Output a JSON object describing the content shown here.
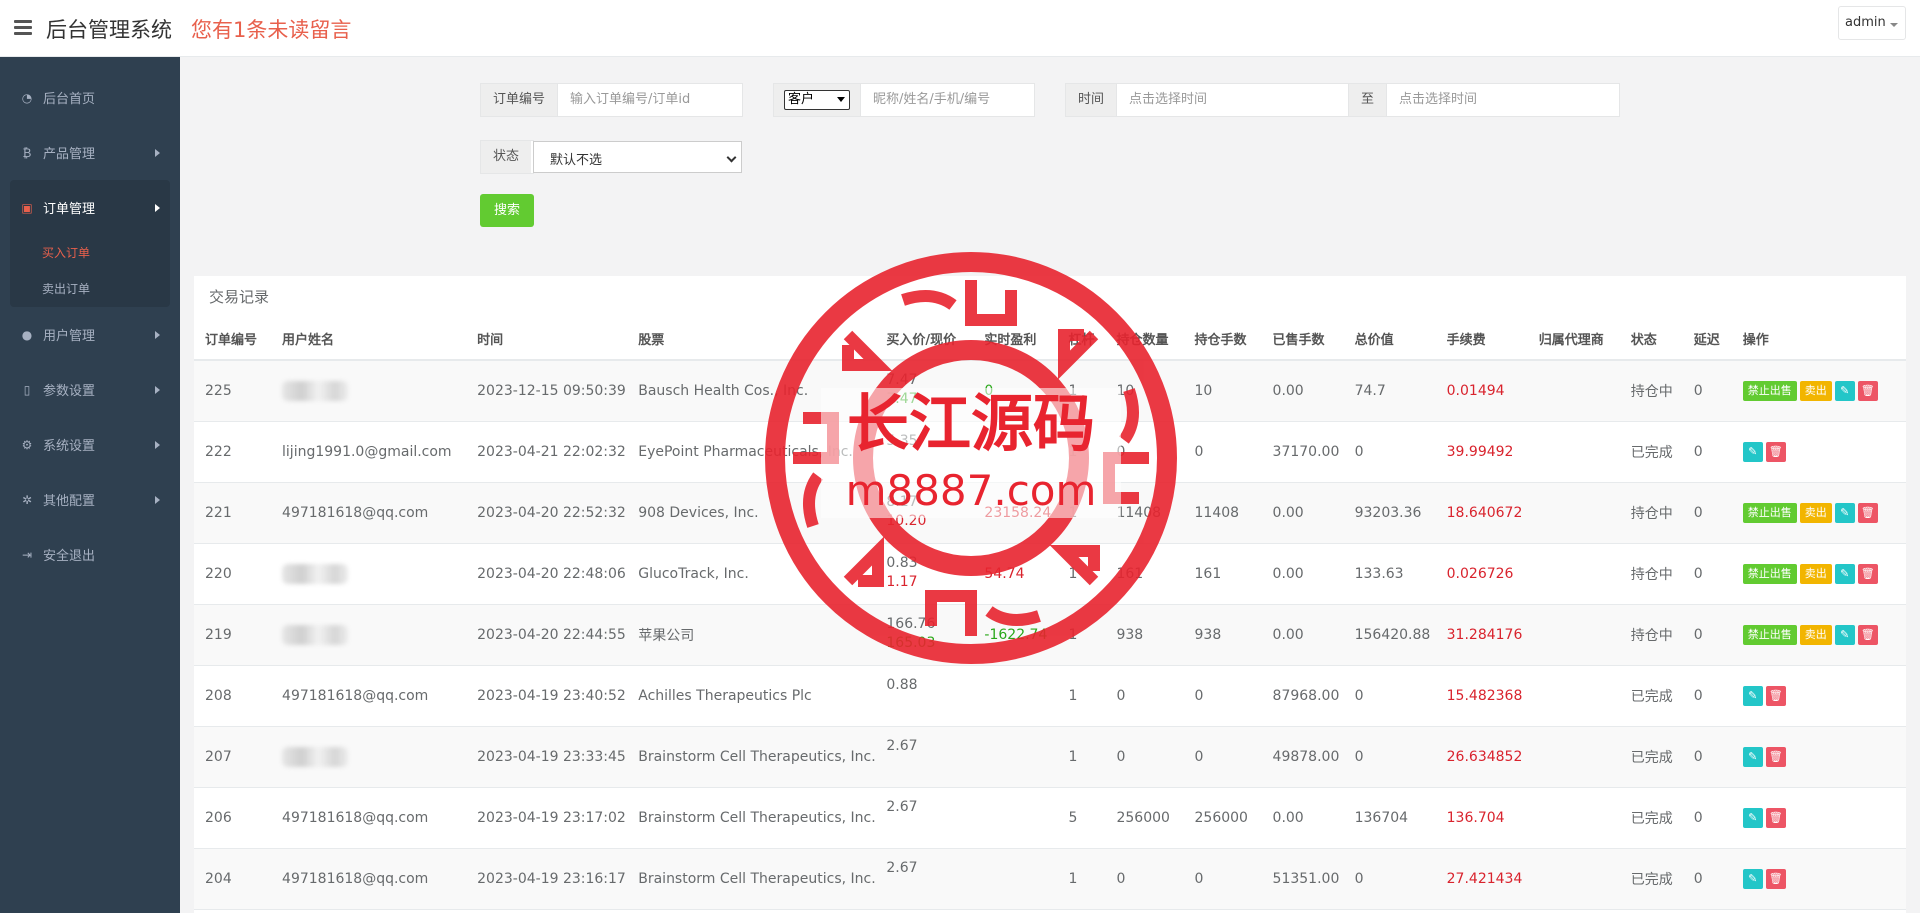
{
  "header": {
    "title": "后台管理系统",
    "unread_notice": "您有1条未读留言",
    "user_menu": "admin"
  },
  "sidebar": {
    "items": [
      {
        "label": "后台首页",
        "icon": "dashboard-icon"
      },
      {
        "label": "产品管理",
        "icon": "bitcoin-icon"
      },
      {
        "label": "订单管理",
        "icon": "orders-icon",
        "expanded": true
      },
      {
        "label": "用户管理",
        "icon": "user-icon"
      },
      {
        "label": "参数设置",
        "icon": "file-icon"
      },
      {
        "label": "系统设置",
        "icon": "gears-icon"
      },
      {
        "label": "其他配置",
        "icon": "gear-icon"
      },
      {
        "label": "安全退出",
        "icon": "signout-icon"
      }
    ],
    "order_submenu": [
      {
        "label": "买入订单",
        "active": true
      },
      {
        "label": "卖出订单",
        "active": false
      }
    ]
  },
  "filters": {
    "order_no_label": "订单编号",
    "order_no_placeholder": "输入订单编号/订单id",
    "customer_select": "客户",
    "customer_placeholder": "昵称/姓名/手机/编号",
    "time_label": "时间",
    "time_start_placeholder": "点击选择时间",
    "time_to": "至",
    "time_end_placeholder": "点击选择时间",
    "status_label": "状态",
    "status_value": "默认不选",
    "search_button": "搜索"
  },
  "table": {
    "title": "交易记录",
    "columns": [
      "订单编号",
      "用户姓名",
      "时间",
      "股票",
      "买入价/现价",
      "实时盈利",
      "杠杆",
      "持仓数量",
      "持仓手数",
      "已售手数",
      "总价值",
      "手续费",
      "归属代理商",
      "状态",
      "延迟",
      "操作"
    ],
    "action_labels": {
      "disable_sell": "禁止出售",
      "sell": "卖出"
    },
    "rows": [
      {
        "id": "225",
        "user": "",
        "time": "2023-12-15 09:50:39",
        "stock": "Bausch Health Cos., Inc.",
        "buy": "7.47",
        "cur": "7.47",
        "profit": "0",
        "profit_color": "green",
        "lev": "1",
        "hold_qty": "10",
        "hold_lots": "10",
        "sold": "0.00",
        "total": "74.7",
        "fee": "0.01494",
        "agent": "",
        "status": "持仓中",
        "delay": "0",
        "open": true
      },
      {
        "id": "222",
        "user": "lijing1991.0@gmail.com",
        "time": "2023-04-21 22:02:32",
        "stock": "EyePoint Pharmaceuticals, Inc.",
        "buy": "5.35",
        "cur": "",
        "profit": "",
        "profit_color": "",
        "lev": "1",
        "hold_qty": "0",
        "hold_lots": "0",
        "sold": "37170.00",
        "total": "0",
        "fee": "39.99492",
        "agent": "",
        "status": "已完成",
        "delay": "0",
        "open": false
      },
      {
        "id": "221",
        "user": "497181618@qq.com",
        "time": "2023-04-20 22:52:32",
        "stock": "908 Devices, Inc.",
        "buy": "8.17",
        "cur": "10.20",
        "profit": "23158.24",
        "profit_color": "red",
        "lev": "1",
        "hold_qty": "11408",
        "hold_lots": "11408",
        "sold": "0.00",
        "total": "93203.36",
        "fee": "18.640672",
        "agent": "",
        "status": "持仓中",
        "delay": "0",
        "open": true
      },
      {
        "id": "220",
        "user": "",
        "time": "2023-04-20 22:48:06",
        "stock": "GlucoTrack, Inc.",
        "buy": "0.83",
        "cur": "1.17",
        "profit": "54.74",
        "profit_color": "red",
        "lev": "1",
        "hold_qty": "161",
        "hold_lots": "161",
        "sold": "0.00",
        "total": "133.63",
        "fee": "0.026726",
        "agent": "",
        "status": "持仓中",
        "delay": "0",
        "open": true
      },
      {
        "id": "219",
        "user": "",
        "time": "2023-04-20 22:44:55",
        "stock": "苹果公司",
        "buy": "166.76",
        "cur": "165.03",
        "profit": "-1622.74",
        "profit_color": "green",
        "lev": "1",
        "hold_qty": "938",
        "hold_lots": "938",
        "sold": "0.00",
        "total": "156420.88",
        "fee": "31.284176",
        "agent": "",
        "status": "持仓中",
        "delay": "0",
        "open": true
      },
      {
        "id": "208",
        "user": "497181618@qq.com",
        "time": "2023-04-19 23:40:52",
        "stock": "Achilles Therapeutics Plc",
        "buy": "0.88",
        "cur": "",
        "profit": "",
        "profit_color": "",
        "lev": "1",
        "hold_qty": "0",
        "hold_lots": "0",
        "sold": "87968.00",
        "total": "0",
        "fee": "15.482368",
        "agent": "",
        "status": "已完成",
        "delay": "0",
        "open": false
      },
      {
        "id": "207",
        "user": "",
        "time": "2023-04-19 23:33:45",
        "stock": "Brainstorm Cell Therapeutics, Inc.",
        "buy": "2.67",
        "cur": "",
        "profit": "",
        "profit_color": "",
        "lev": "1",
        "hold_qty": "0",
        "hold_lots": "0",
        "sold": "49878.00",
        "total": "0",
        "fee": "26.634852",
        "agent": "",
        "status": "已完成",
        "delay": "0",
        "open": false
      },
      {
        "id": "206",
        "user": "497181618@qq.com",
        "time": "2023-04-19 23:17:02",
        "stock": "Brainstorm Cell Therapeutics, Inc.",
        "buy": "2.67",
        "cur": "",
        "profit": "",
        "profit_color": "",
        "lev": "5",
        "hold_qty": "256000",
        "hold_lots": "256000",
        "sold": "0.00",
        "total": "136704",
        "fee": "136.704",
        "agent": "",
        "status": "已完成",
        "delay": "0",
        "open": false
      },
      {
        "id": "204",
        "user": "497181618@qq.com",
        "time": "2023-04-19 23:16:17",
        "stock": "Brainstorm Cell Therapeutics, Inc.",
        "buy": "2.67",
        "cur": "",
        "profit": "",
        "profit_color": "",
        "lev": "1",
        "hold_qty": "0",
        "hold_lots": "0",
        "sold": "51351.00",
        "total": "0",
        "fee": "27.421434",
        "agent": "",
        "status": "已完成",
        "delay": "0",
        "open": false
      }
    ]
  },
  "watermark": {
    "title": "长江源码",
    "url": "m8887.com",
    "color": "#e8242f"
  }
}
